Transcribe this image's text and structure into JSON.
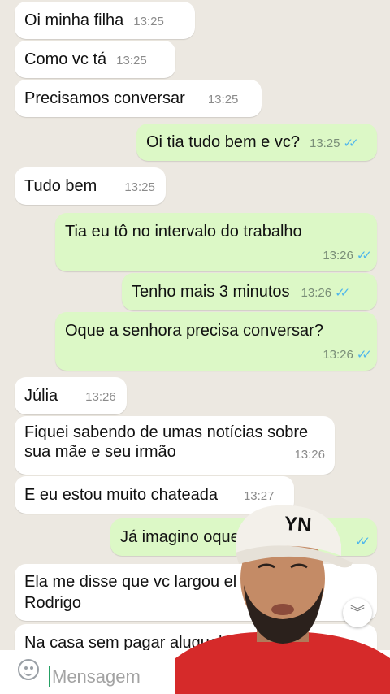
{
  "messages": [
    {
      "text": "Oi minha filha",
      "time": "13:25",
      "dir": "in"
    },
    {
      "text": "Como vc tá",
      "time": "13:25",
      "dir": "in"
    },
    {
      "text": "Precisamos conversar",
      "time": "13:25",
      "dir": "in"
    },
    {
      "text": "Oi tia tudo bem e vc?",
      "time": "13:25",
      "dir": "out"
    },
    {
      "text": "Tudo bem",
      "time": "13:25",
      "dir": "in"
    },
    {
      "text": "Tia eu tô no intervalo do trabalho",
      "time": "13:26",
      "dir": "out"
    },
    {
      "text": "Tenho mais 3 minutos",
      "time": "13:26",
      "dir": "out"
    },
    {
      "text": "Oque a senhora precisa conversar?",
      "time": "13:26",
      "dir": "out"
    },
    {
      "text": "Júlia",
      "time": "13:26",
      "dir": "in"
    },
    {
      "text": "Fiquei sabendo de umas notícias sobre sua mãe e seu irmão",
      "time": "13:26",
      "dir": "in"
    },
    {
      "text": "E eu estou muito chateada",
      "time": "13:27",
      "dir": "in"
    },
    {
      "text": "Já imagino oque",
      "time": "",
      "dir": "out"
    },
    {
      "text": "Ela me disse que vc largou el Rodrigo",
      "time": "",
      "dir": "in"
    },
    {
      "text": "Na casa sem pagar aluguel",
      "time": "",
      "dir": "in"
    }
  ],
  "tick_icon": "double-check-icon",
  "compose": {
    "placeholder": "Mensagem",
    "emoji_icon": "emoji-icon"
  },
  "scroll_icon": "chevron-double-down-icon",
  "cap_text": "YN",
  "colors": {
    "background": "#ece8e1",
    "outgoing": "#dcf8c6",
    "incoming": "#ffffff",
    "tick": "#4fb6ec",
    "shirt": "#d62a2a"
  }
}
